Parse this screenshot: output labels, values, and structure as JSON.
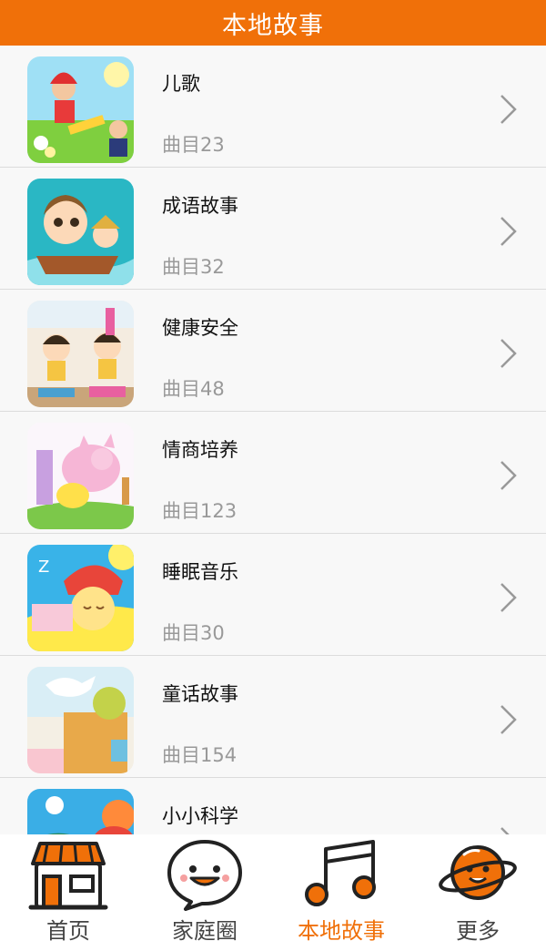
{
  "header": {
    "title": "本地故事"
  },
  "items": [
    {
      "title": "儿歌",
      "count": "曲目23"
    },
    {
      "title": "成语故事",
      "count": "曲目32"
    },
    {
      "title": "健康安全",
      "count": "曲目48"
    },
    {
      "title": "情商培养",
      "count": "曲目123"
    },
    {
      "title": "睡眠音乐",
      "count": "曲目30"
    },
    {
      "title": "童话故事",
      "count": "曲目154"
    },
    {
      "title": "小小科学",
      "count": ""
    }
  ],
  "tabs": [
    {
      "label": "首页",
      "icon": "home-shop-icon"
    },
    {
      "label": "家庭圈",
      "icon": "smile-chat-icon"
    },
    {
      "label": "本地故事",
      "icon": "music-note-icon"
    },
    {
      "label": "更多",
      "icon": "planet-icon"
    }
  ],
  "colors": {
    "accent": "#f07009",
    "header_text": "#ffffff",
    "muted": "#999999"
  }
}
